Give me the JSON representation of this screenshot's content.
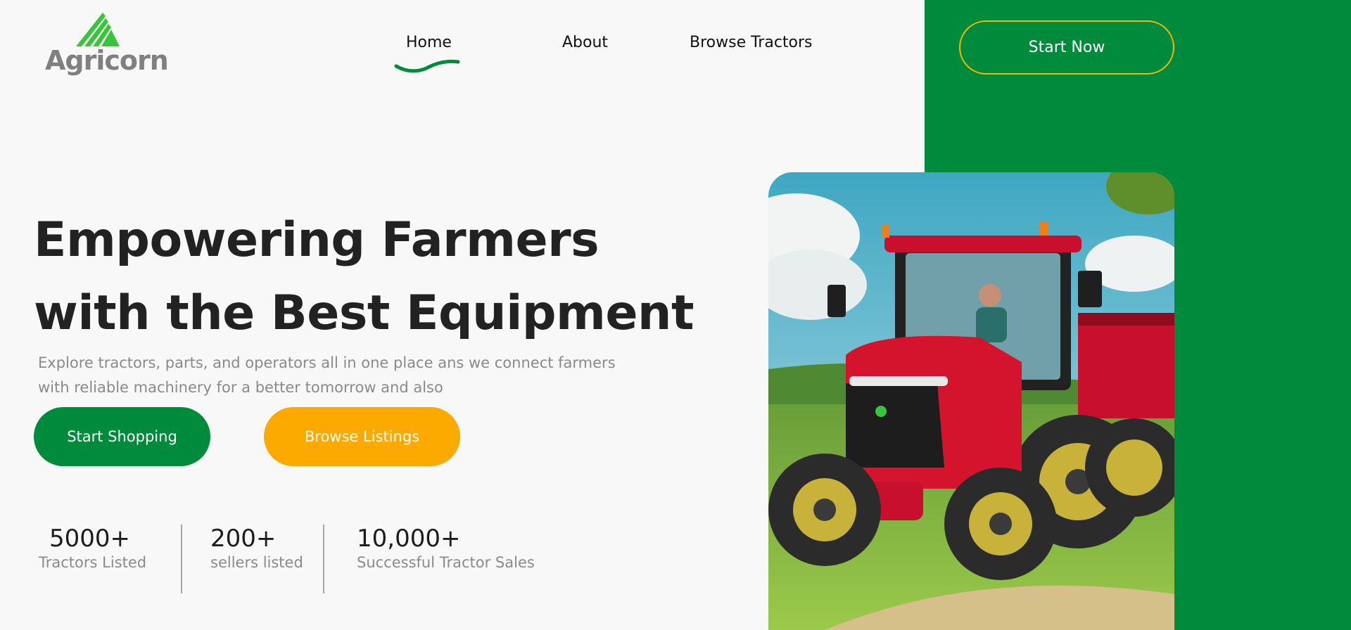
{
  "brand": {
    "name": "Agricorn",
    "colors": {
      "primary_green": "#008a3c",
      "accent_orange": "#fca900",
      "outline_gold": "#f5b700",
      "logo_green": "#36c53b"
    },
    "logo_icon": "wheat-stripes-logo"
  },
  "nav": {
    "items": [
      {
        "label": "Home",
        "active": true
      },
      {
        "label": "About",
        "active": false
      },
      {
        "label": "Browse Tractors",
        "active": false
      }
    ],
    "cta_label": "Start Now"
  },
  "hero": {
    "headline_line1": "Empowering Farmers",
    "headline_line2": "with the Best Equipment",
    "description_line1": "Explore tractors, parts, and operators all in one place ans we connect farmers",
    "description_line2": "with reliable machinery for a better tomorrow  and also",
    "primary_button": "Start Shopping",
    "secondary_button": "Browse Listings",
    "image": "red-tractor-photo"
  },
  "stats": [
    {
      "value": "5000+",
      "label": "Tractors Listed"
    },
    {
      "value": "200+",
      "label": "sellers listed"
    },
    {
      "value": "10,000+",
      "label": "Successful Tractor Sales"
    }
  ]
}
